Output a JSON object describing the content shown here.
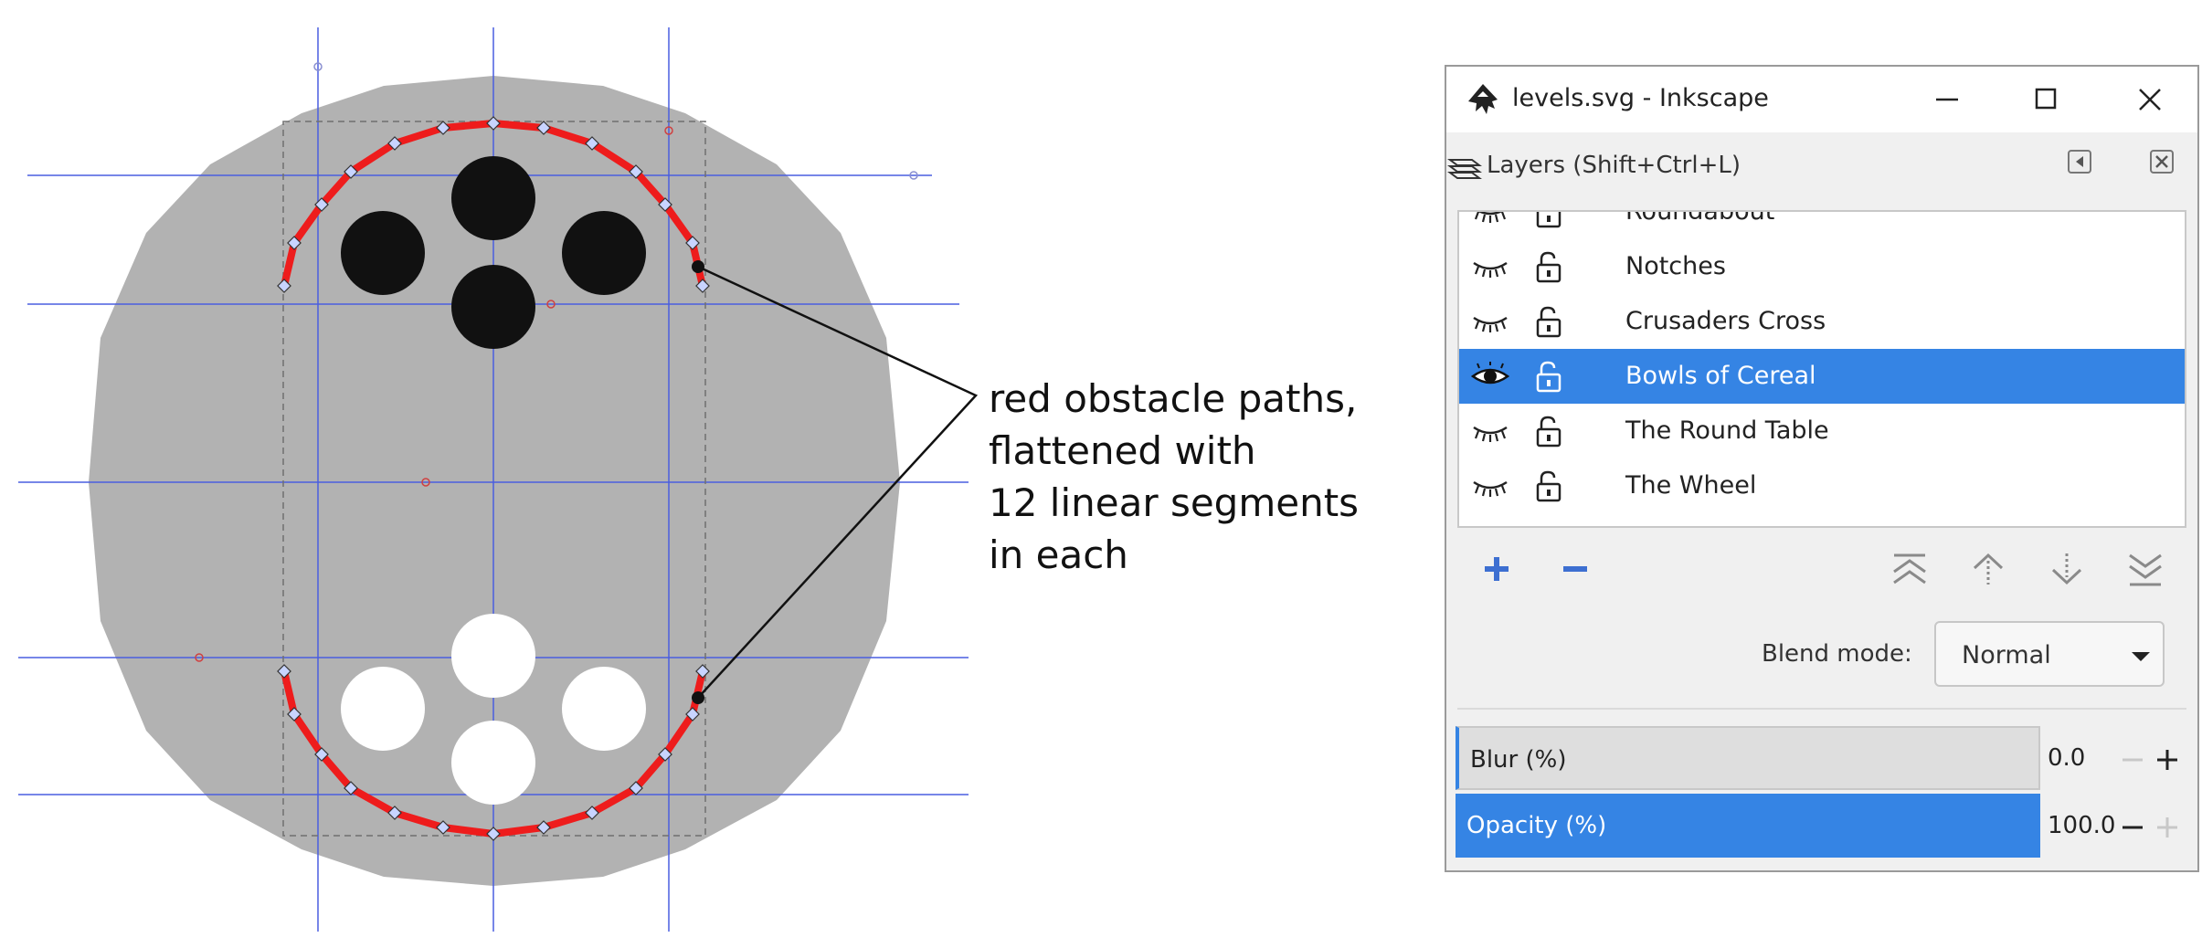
{
  "annotation": {
    "lines": [
      "red obstacle paths,",
      "flattened with",
      "12 linear segments",
      "in each"
    ]
  },
  "colors": {
    "disc": "#b2b2b2",
    "guide": "#4a5ee0",
    "obstacle": "#ee1c1c",
    "selection": "#3584e4",
    "filled_circle": "#111111",
    "hole": "#ffffff"
  },
  "window": {
    "title": "levels.svg - Inkscape",
    "icon": "inkscape-logo-icon",
    "controls": [
      "minimize-icon",
      "maximize-icon",
      "close-icon"
    ]
  },
  "dock": {
    "title": "Layers (Shift+Ctrl+L)",
    "icon": "layers-icon",
    "buttons": [
      "undock-icon",
      "close-panel-icon"
    ]
  },
  "layers": {
    "items": [
      {
        "name": "Roundabout",
        "visible": true,
        "locked": false,
        "selected": false
      },
      {
        "name": "Notches",
        "visible": false,
        "locked": false,
        "selected": false
      },
      {
        "name": "Crusaders Cross",
        "visible": false,
        "locked": false,
        "selected": false
      },
      {
        "name": "Bowls of Cereal",
        "visible": true,
        "locked": false,
        "selected": true
      },
      {
        "name": "The Round Table",
        "visible": false,
        "locked": false,
        "selected": false
      },
      {
        "name": "The Wheel",
        "visible": false,
        "locked": false,
        "selected": false
      }
    ]
  },
  "toolbar": {
    "buttons": [
      "add-layer-icon",
      "remove-layer-icon",
      "layer-to-top-icon",
      "layer-up-icon",
      "layer-down-icon",
      "layer-to-bottom-icon"
    ]
  },
  "blend": {
    "label": "Blend mode:",
    "value": "Normal"
  },
  "sliders": {
    "blur": {
      "label": "Blur (%)",
      "value": "0.0"
    },
    "opacity": {
      "label": "Opacity (%)",
      "value": "100.0"
    }
  }
}
